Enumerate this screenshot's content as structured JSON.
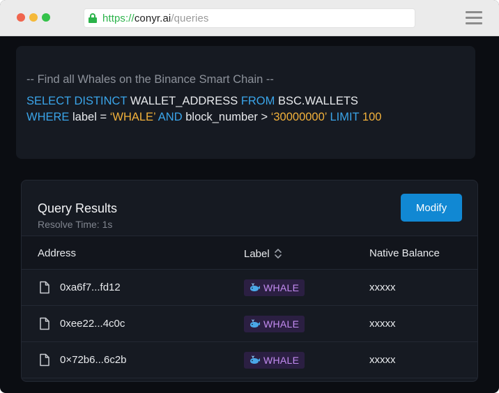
{
  "browser": {
    "url_scheme": "https://",
    "url_host": "conyr.ai",
    "url_path": "/queries"
  },
  "query": {
    "comment": "-- Find all Whales on the Binance Smart Chain --",
    "line1": {
      "kw1": "SELECT DISTINCT",
      "col": "WALLET_ADDRESS",
      "kw2": "FROM",
      "table": "BSC.WALLETS"
    },
    "line2": {
      "kw1": "WHERE",
      "cond1": "label =",
      "val1": "‘WHALE’",
      "kw2": "AND",
      "cond2": "block_number >",
      "val2": "‘30000000’",
      "kw3": "LIMIT",
      "limit": "100"
    }
  },
  "results": {
    "title": "Query Results",
    "resolve_time": "Resolve Time: 1s",
    "modify_label": "Modify",
    "columns": [
      "Address",
      "Label",
      "Native Balance"
    ],
    "rows": [
      {
        "address": "0xa6f7...fd12",
        "label": "WHALE",
        "balance": "xxxxx"
      },
      {
        "address": "0xee22...4c0c",
        "label": "WHALE",
        "balance": "xxxxx"
      },
      {
        "address": "0×72b6...6c2b",
        "label": "WHALE",
        "balance": "xxxxx"
      }
    ]
  },
  "icons": {
    "lock": "lock-icon",
    "menu": "hamburger-menu-icon",
    "sort": "sort-icon",
    "file": "file-icon",
    "whale": "whale-icon"
  },
  "colors": {
    "keyword": "#3aa5ea",
    "string": "#f2b13b",
    "comment": "#8d929b",
    "primary_button": "#1188d3",
    "badge_bg": "#2b1f42",
    "badge_text": "#c48cf2",
    "secure_green": "#2bb34a"
  }
}
